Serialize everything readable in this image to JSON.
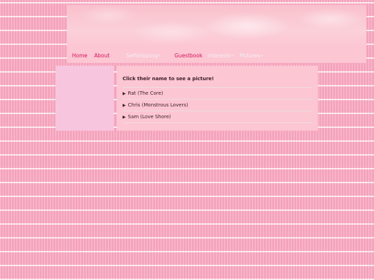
{
  "nav": {
    "home": "Home",
    "about": "About",
    "selfshipping": "Selfshipping",
    "guestbook": "Guestbook",
    "interests": "Interests",
    "pictures": "Pictures",
    "caret": "▾"
  },
  "main": {
    "intro": "Click their name to see a picture!",
    "marker": "▶",
    "entries": [
      {
        "label": "Rat (The Core)"
      },
      {
        "label": "Chris (Monstrous Lovers)"
      },
      {
        "label": "Sam (Love Shore)"
      }
    ]
  },
  "colors": {
    "background": "#f5a3bc",
    "panel": "#fcc6d3",
    "sidebar": "#f8c5de",
    "nav_active": "#d4145a",
    "nav_faded": "#f5f0f3"
  },
  "icons": {
    "dropdown": "chevron-down-icon",
    "disclosure": "triangle-right-icon"
  }
}
